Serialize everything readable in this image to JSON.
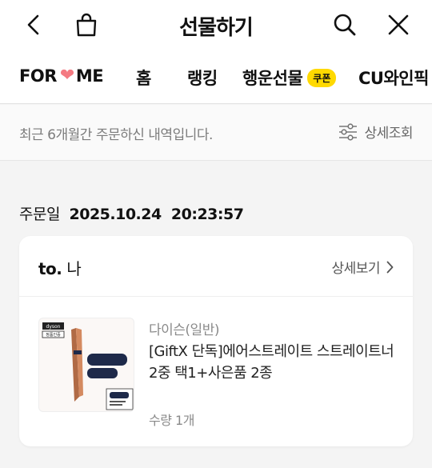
{
  "header": {
    "title": "선물하기",
    "back_icon": "chevron-left-icon",
    "bag_icon": "shopping-bag-icon",
    "search_icon": "search-icon",
    "close_icon": "close-icon"
  },
  "tabs": {
    "for_me_prefix": "FOR",
    "for_me_suffix": "ME",
    "heart_glyph": "❤",
    "home": "홈",
    "ranking": "랭킹",
    "lucky_gift": "행운선물",
    "coupon_badge": "쿠폰",
    "cu_wine": "CU와인픽"
  },
  "notice": {
    "text": "최근 6개월간 주문하신 내역입니다.",
    "detail_label": "상세조회"
  },
  "order": {
    "date_label": "주문일",
    "date_value": "2025.10.24  20:23:57",
    "to_prefix": "to.",
    "to_name": "나",
    "more_label": "상세보기",
    "product": {
      "brand": "다이슨(일반)",
      "name": "[GiftX 단독]에어스트레이트 스트레이트너 2중 택1+사은품 2종",
      "quantity": "수량 1개",
      "thumb_brand": "dyson",
      "thumb_tag": "정품인증"
    }
  },
  "colors": {
    "heart": "#f47a82",
    "coupon": "#ffd900",
    "background": "#f4f4f4"
  }
}
